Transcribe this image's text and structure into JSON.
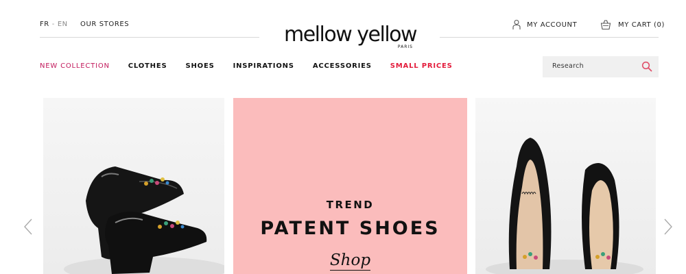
{
  "header": {
    "lang_fr": "FR",
    "lang_sep": "-",
    "lang_en": "EN",
    "stores": "OUR STORES",
    "logo_word": "mellow yellow",
    "logo_sub": "PARIS",
    "account": "MY ACCOUNT",
    "cart": "MY CART (0)"
  },
  "nav": {
    "items": [
      {
        "label": "NEW COLLECTION"
      },
      {
        "label": "CLOTHES"
      },
      {
        "label": "SHOES"
      },
      {
        "label": "INSPIRATIONS"
      },
      {
        "label": "ACCESSORIES"
      },
      {
        "label": "SMALL PRICES"
      }
    ]
  },
  "search": {
    "placeholder": "Research"
  },
  "hero": {
    "kicker": "TREND",
    "title": "PATENT SHOES",
    "cta": "Shop"
  },
  "colors": {
    "accent_magenta": "#c2185b",
    "accent_red": "#e31b3b",
    "hero_pink": "#fbbcbc",
    "search_bg": "#f0f0f0"
  },
  "icons": {
    "account": "person-icon",
    "cart": "basket-icon",
    "search": "search-icon",
    "prev": "chevron-left-icon",
    "next": "chevron-right-icon"
  }
}
